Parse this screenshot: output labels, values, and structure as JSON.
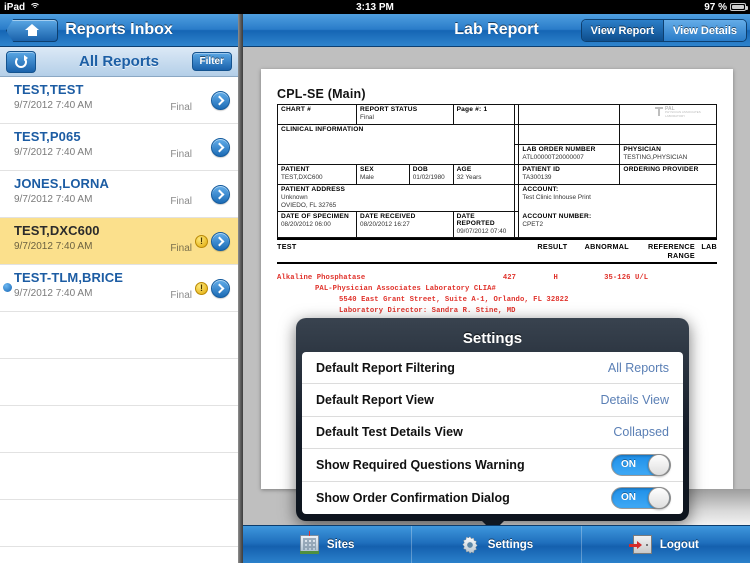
{
  "statusbar": {
    "device": "iPad",
    "time": "3:13 PM",
    "battery": "97 %",
    "wifi_icon": "wifi-icon",
    "battery_icon": "battery-icon"
  },
  "master": {
    "nav_title": "Reports Inbox",
    "home_icon": "home-icon",
    "subnav_title": "All Reports",
    "refresh_icon": "refresh-icon",
    "filter_label": "Filter",
    "rows": [
      {
        "name": "TEST,TEST",
        "date": "9/7/2012 7:40 AM",
        "status": "Final",
        "selected": false,
        "unread": false,
        "warning": false
      },
      {
        "name": "TEST,P065",
        "date": "9/7/2012 7:40 AM",
        "status": "Final",
        "selected": false,
        "unread": false,
        "warning": false
      },
      {
        "name": "JONES,LORNA",
        "date": "9/7/2012 7:40 AM",
        "status": "Final",
        "selected": false,
        "unread": false,
        "warning": false
      },
      {
        "name": "TEST,DXC600",
        "date": "9/7/2012 7:40 AM",
        "status": "Final",
        "selected": true,
        "unread": false,
        "warning": true
      },
      {
        "name": "TEST-TLM,BRICE",
        "date": "9/7/2012 7:40 AM",
        "status": "Final",
        "selected": false,
        "unread": true,
        "warning": true
      }
    ],
    "empty_rows": 5
  },
  "detail": {
    "nav_title": "Lab Report",
    "share_icon": "share-icon",
    "segments": [
      {
        "label": "View Report",
        "active": false
      },
      {
        "label": "View Details",
        "active": true
      }
    ]
  },
  "report": {
    "title": "CPL-SE (Main)",
    "logo": {
      "line1": "PAL",
      "line2": "PHYSICIAN ASSOCIATES",
      "line3": "LABORATORY"
    },
    "chart_label": "CHART #",
    "chart_value": "",
    "report_status_label": "REPORT STATUS",
    "report_status_value": "Final",
    "page_label": "Page #: 1",
    "clinical_info_label": "CLINICAL INFORMATION",
    "clinical_info_value": "",
    "lab_order_number_label": "LAB ORDER NUMBER",
    "lab_order_number_value": "ATL00000T20000007",
    "physician_label": "PHYSICIAN",
    "physician_value": "TESTING,PHYSICIAN",
    "patient_label": "PATIENT",
    "patient_value": "TEST,DXC600",
    "sex_label": "SEX",
    "sex_value": "Male",
    "dob_label": "DOB",
    "dob_value": "01/02/1980",
    "age_label": "AGE",
    "age_value": "32 Years",
    "patient_id_label": "PATIENT ID",
    "patient_id_value": "TA300139",
    "ordering_provider_label": "ORDERING PROVIDER",
    "ordering_provider_value": "",
    "patient_address_label": "PATIENT ADDRESS",
    "patient_address_line1": "Unknown",
    "patient_address_line2": "OVIEDO, FL 32765",
    "account_label": "ACCOUNT:",
    "account_value": "Test Clinic Inhouse Print",
    "date_specimen_label": "DATE OF SPECIMEN",
    "date_specimen_value": "08/20/2012 06:00",
    "date_received_label": "DATE RECEIVED",
    "date_received_value": "08/20/2012 16:27",
    "date_reported_label": "DATE REPORTED",
    "date_reported_value": "09/07/2012 07:40",
    "account_number_label": "ACCOUNT NUMBER:",
    "account_number_value": "CPET2",
    "columns": {
      "test": "TEST",
      "result": "RESULT",
      "abnormal": "ABNORMAL",
      "reference_range": "REFERENCE RANGE",
      "lab": "LAB"
    },
    "results": [
      {
        "test": "Alkaline Phosphatase",
        "result": "427",
        "abnormal": "H",
        "reference_range": "35-126 U/L",
        "lab": ""
      }
    ],
    "lab_footer": [
      "PAL-Physician Associates Laboratory CLIA#",
      "5540 East Grant Street, Suite A-1, Orlando, FL 32822",
      "Laboratory Director: Sandra R. Stine, MD"
    ]
  },
  "settings_modal": {
    "title": "Settings",
    "rows": [
      {
        "label": "Default Report Filtering",
        "value": "All Reports",
        "type": "value"
      },
      {
        "label": "Default Report View",
        "value": "Details View",
        "type": "value"
      },
      {
        "label": "Default Test Details View",
        "value": "Collapsed",
        "type": "value"
      },
      {
        "label": "Show Required Questions Warning",
        "value": "ON",
        "type": "toggle"
      },
      {
        "label": "Show Order Confirmation Dialog",
        "value": "ON",
        "type": "toggle"
      }
    ]
  },
  "tabbar": {
    "tabs": [
      {
        "label": "Sites",
        "icon": "building-icon"
      },
      {
        "label": "Settings",
        "icon": "gear-icon"
      },
      {
        "label": "Logout",
        "icon": "logout-door-icon"
      }
    ]
  }
}
